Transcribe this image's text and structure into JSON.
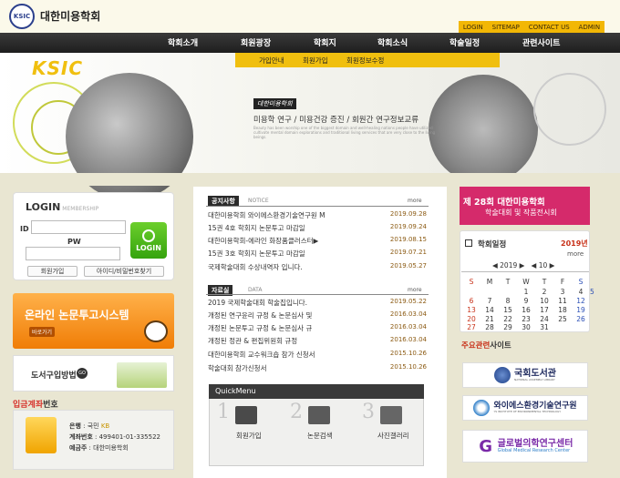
{
  "header": {
    "logo_text": "KSIC",
    "site_title": "대한미용학회",
    "util_links": [
      "LOGIN",
      "SITEMAP",
      "CONTACT US",
      "ADMIN"
    ]
  },
  "nav": {
    "items": [
      "학회소개",
      "회원광장",
      "학회지",
      "학회소식",
      "학술일정",
      "관련사이트"
    ],
    "subitems": [
      "가입안내",
      "회원가입",
      "회원정보수정"
    ]
  },
  "hero": {
    "logo": "KSIC",
    "badge": "대한미용학회",
    "slogan": "미용학 연구 / 미용건강 증진 / 회원간 연구정보교류",
    "subtext": "Beauty has been worship one of the biggest domain and well-healing nations people have utilized cultivate mental domain explorations and traditional living services that are very close to the living beings."
  },
  "login": {
    "title": "LOGIN",
    "title_sub": "MEMBERSHIP",
    "id_label": "ID",
    "pw_label": "PW",
    "button": "LOGIN",
    "join": "회원가입",
    "find": "아이디/비밀번호찾기"
  },
  "submit_banner": {
    "title": "온라인 논문투고시스템",
    "sub": "바로가기"
  },
  "book_banner": {
    "text": "도서구입방법",
    "go": "GO"
  },
  "account": {
    "title_red": "입금계좌",
    "title_dark": "번호",
    "bank_label": "은행",
    "bank_value": "국민",
    "bank_tag": "KB",
    "account_label": "계좌번호",
    "account_value": "499401-01-335522",
    "holder_label": "예금주",
    "holder_value": "대한미용학회"
  },
  "notice": {
    "tag": "공지사항",
    "tag_en": "NOTICE",
    "more": "more",
    "posts": [
      {
        "title": "대한미용학회 와이에스환경기술연구원 M",
        "date": "2019.09.28"
      },
      {
        "title": "15권 4호 학회지 논문투고 마감일",
        "date": "2019.09.24"
      },
      {
        "title": "대한미용학회-에라인 화장품클러스터▶",
        "date": "2019.08.15"
      },
      {
        "title": "15권 3호 학회지 논문투고 마감일",
        "date": "2019.07.21"
      },
      {
        "title": "국제학술대회 수상내역자 입니다.",
        "date": "2019.05.27"
      }
    ]
  },
  "data_board": {
    "tag": "자료실",
    "tag_en": "DATA",
    "more": "more",
    "posts": [
      {
        "title": "2019 국제학술대회 학술집입니다.",
        "date": "2019.05.22"
      },
      {
        "title": "개정된 연구윤리 규정 & 논문심사 및",
        "date": "2016.03.04"
      },
      {
        "title": "개정된 논문투고 규정 & 논문심사 규",
        "date": "2016.03.04"
      },
      {
        "title": "개정된 정관 & 편집위원회 규정",
        "date": "2016.03.04"
      },
      {
        "title": "대한미용학회 교수워크숍 참가 신청서",
        "date": "2015.10.26"
      },
      {
        "title": "학술대회 참가신청서",
        "date": "2015.10.26"
      }
    ]
  },
  "quickmenu": {
    "title": "QuickMenu",
    "items": [
      {
        "num": "1",
        "label": "회원가입"
      },
      {
        "num": "2",
        "label": "논문검색"
      },
      {
        "num": "3",
        "label": "사진갤러리"
      }
    ]
  },
  "conference": {
    "line1": "제 28회 대한미용학회",
    "line2": "학술대회 및 작품전시회"
  },
  "calendar": {
    "title": "학회일정",
    "year": "2019년",
    "more": "more",
    "nav_year": "◀ 2019 ▶",
    "nav_month": "◀ 10 ▶",
    "weekdays": [
      "S",
      "M",
      "T",
      "W",
      "T",
      "F",
      "S"
    ],
    "weeks": [
      [
        "",
        "",
        "1",
        "2",
        "3",
        "4",
        "5"
      ],
      [
        "6",
        "7",
        "8",
        "9",
        "10",
        "11",
        "12"
      ],
      [
        "13",
        "14",
        "15",
        "16",
        "17",
        "18",
        "19"
      ],
      [
        "20",
        "21",
        "22",
        "23",
        "24",
        "25",
        "26"
      ],
      [
        "27",
        "28",
        "29",
        "30",
        "31",
        "",
        ""
      ]
    ]
  },
  "related": {
    "title_red": "주요관련",
    "title_dark": "사이트",
    "links": [
      {
        "name": "국회도서관",
        "sub": "NATIONAL ASSEMBLY LIBRARY"
      },
      {
        "name": "와이에스환경기술연구원",
        "sub": "YS INSTITUTE OF ENVIRONMENTAL TECHNOLOGY"
      },
      {
        "name": "글로벌의학연구센터",
        "sub": "Global Medical Research Center"
      }
    ]
  }
}
